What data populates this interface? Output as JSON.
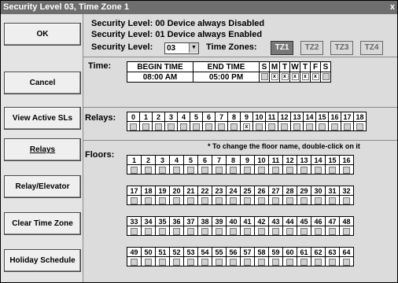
{
  "window": {
    "title": "Security Level 03, Time Zone 1",
    "close_glyph": "x"
  },
  "sidebar": {
    "buttons": [
      {
        "label": "OK",
        "underlined": false
      },
      {
        "label": "Cancel",
        "underlined": false
      },
      {
        "label": "View Active SLs",
        "underlined": false
      },
      {
        "label": "Relays",
        "underlined": true
      },
      {
        "label": "Relay/Elevator",
        "underlined": false
      },
      {
        "label": "Clear Time Zone",
        "underlined": false
      },
      {
        "label": "Holiday Schedule",
        "underlined": false
      }
    ]
  },
  "header": {
    "line1": "Security Level:  00 Device always Disabled",
    "line2": "Security Level:  01 Device always Enabled",
    "sl_label": "Security Level:",
    "sl_value": "03",
    "tz_label": "Time Zones:",
    "timezones": [
      "TZ1",
      "TZ2",
      "TZ3",
      "TZ4"
    ],
    "active_timezone": "TZ1"
  },
  "time": {
    "label": "Time:",
    "begin_header": "BEGIN TIME",
    "end_header": "END TIME",
    "begin_value": "08:00 AM",
    "end_value": "05:00 PM",
    "days": [
      "S",
      "M",
      "T",
      "W",
      "T",
      "F",
      "S"
    ],
    "days_checked": [
      false,
      true,
      true,
      true,
      true,
      true,
      false
    ]
  },
  "relays": {
    "label": "Relays:",
    "numbers": [
      "0",
      "1",
      "2",
      "3",
      "4",
      "5",
      "6",
      "7",
      "8",
      "9",
      "10",
      "11",
      "12",
      "13",
      "14",
      "15",
      "16",
      "17",
      "18"
    ],
    "checked": [
      false,
      false,
      false,
      false,
      false,
      false,
      false,
      false,
      false,
      true,
      false,
      false,
      false,
      false,
      false,
      false,
      false,
      false,
      false
    ]
  },
  "floors": {
    "label": "Floors:",
    "note": "* To change the floor name, double-click on it",
    "rows": [
      [
        "1",
        "2",
        "3",
        "4",
        "5",
        "6",
        "7",
        "8",
        "9",
        "10",
        "11",
        "12",
        "13",
        "14",
        "15",
        "16"
      ],
      [
        "17",
        "18",
        "19",
        "20",
        "21",
        "22",
        "23",
        "24",
        "25",
        "26",
        "27",
        "28",
        "29",
        "30",
        "31",
        "32"
      ],
      [
        "33",
        "34",
        "35",
        "36",
        "37",
        "38",
        "39",
        "40",
        "41",
        "42",
        "43",
        "44",
        "45",
        "46",
        "47",
        "48"
      ],
      [
        "49",
        "50",
        "51",
        "52",
        "53",
        "54",
        "55",
        "56",
        "57",
        "58",
        "59",
        "60",
        "61",
        "62",
        "63",
        "64"
      ]
    ]
  },
  "icons": {
    "checkbox_check": "x",
    "dropdown_arrow": "▼"
  }
}
